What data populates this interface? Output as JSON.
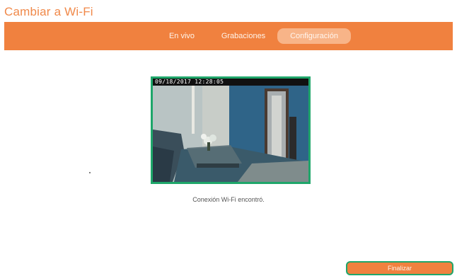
{
  "page": {
    "title": "Cambiar a Wi-Fi"
  },
  "nav": {
    "tabs": [
      {
        "label": "En vivo",
        "active": false
      },
      {
        "label": "Grabaciones",
        "active": false
      },
      {
        "label": "Configuración",
        "active": true
      }
    ]
  },
  "camera": {
    "timestamp": "09/18/2017 12:28:05"
  },
  "status": {
    "message": "Conexión Wi-Fi encontró."
  },
  "actions": {
    "finish_label": "Finalizar"
  },
  "colors": {
    "accent": "#f0813f",
    "active_tab": "#f8b488",
    "focus_border": "#1fa66a",
    "title": "#f0894a"
  }
}
